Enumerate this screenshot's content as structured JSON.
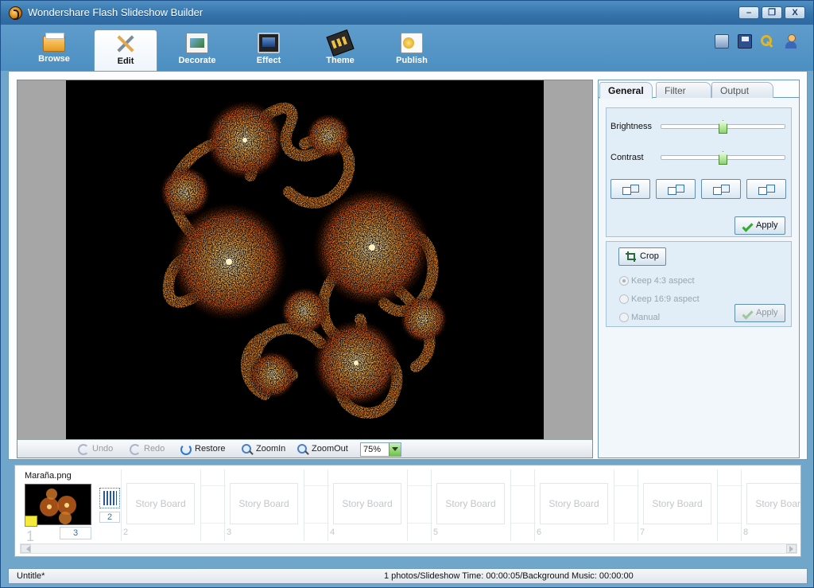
{
  "window": {
    "title": "Wondershare Flash Slideshow Builder",
    "controls": [
      "–",
      "❐",
      "X"
    ]
  },
  "toolbar": {
    "tabs": [
      {
        "label": "Browse",
        "icon": "folder-icon"
      },
      {
        "label": "Edit",
        "icon": "edit-tools-icon",
        "active": true
      },
      {
        "label": "Decorate",
        "icon": "decorate-icon"
      },
      {
        "label": "Effect",
        "icon": "effect-icon"
      },
      {
        "label": "Theme",
        "icon": "theme-icon"
      },
      {
        "label": "Publish",
        "icon": "publish-icon"
      }
    ],
    "right_icons": [
      "settings-icon",
      "save-icon",
      "key-icon",
      "user-icon"
    ]
  },
  "preview": {
    "undo": "Undo",
    "redo": "Redo",
    "restore": "Restore",
    "zoom_in": "ZoomIn",
    "zoom_out": "ZoomOut",
    "zoom_value": "75%"
  },
  "panel": {
    "tabs": [
      "General",
      "Filter",
      "Output"
    ],
    "active_tab": "General",
    "brightness_label": "Brightness",
    "brightness_value": 0.5,
    "contrast_label": "Contrast",
    "contrast_value": 0.5,
    "apply_label": "Apply",
    "crop_label": "Crop",
    "crop_options": [
      "Keep 4:3 aspect",
      "Keep 16:9 aspect",
      "Manual"
    ],
    "crop_selected": "Keep 4:3 aspect",
    "crop_apply_label": "Apply"
  },
  "storyboard": {
    "first_slide": {
      "name": "Maraña.png",
      "number": "1",
      "duration": "3"
    },
    "transition_duration": "2",
    "placeholder_label": "Story Board",
    "slots": [
      "2",
      "3",
      "4",
      "5",
      "6",
      "7",
      "8"
    ]
  },
  "status": {
    "project": "Untitle*",
    "summary": "1 photos/Slideshow Time: 00:00:05/Background Music: 00:00:00"
  },
  "colors": {
    "frame": "#6fa6c9",
    "title_bar": "#3472aa",
    "accent_green": "#2fae2a"
  }
}
